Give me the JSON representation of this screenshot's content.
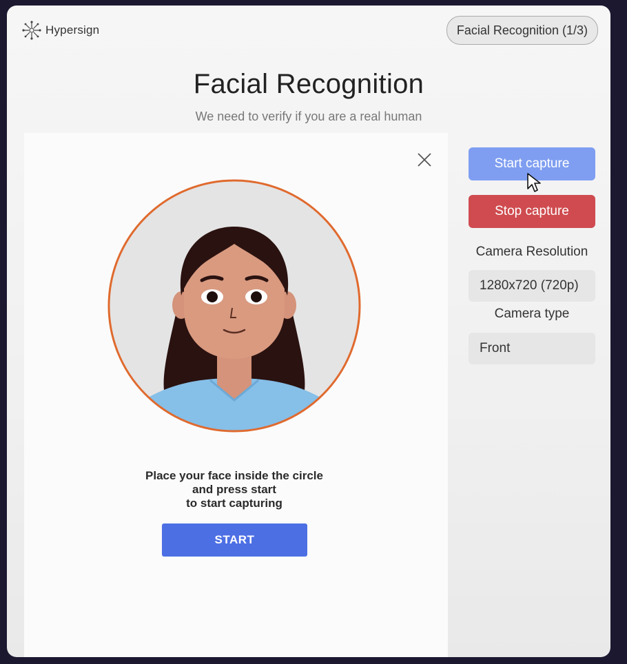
{
  "header": {
    "logo_text": "Hypersign",
    "step_label": "Facial Recognition (1/3)"
  },
  "page": {
    "title": "Facial Recognition",
    "subtitle": "We need to verify if you are a real human"
  },
  "capture_card": {
    "instruction_line1": "Place your face inside the circle",
    "instruction_line2": "and press start",
    "instruction_line3": "to start capturing",
    "start_label": "START",
    "avatar_icon": "woman-avatar-illustration",
    "close_icon": "close-icon"
  },
  "side_panel": {
    "start_capture_label": "Start capture",
    "stop_capture_label": "Stop capture",
    "resolution_label": "Camera Resolution",
    "resolution_value": "1280x720 (720p)",
    "camera_type_label": "Camera type",
    "camera_type_value": "Front"
  },
  "colors": {
    "start_blue": "#4c6fe4",
    "start_capture": "#7f9ef1",
    "stop_capture": "#cf4b4f",
    "circle_ring": "#e06a2e"
  }
}
